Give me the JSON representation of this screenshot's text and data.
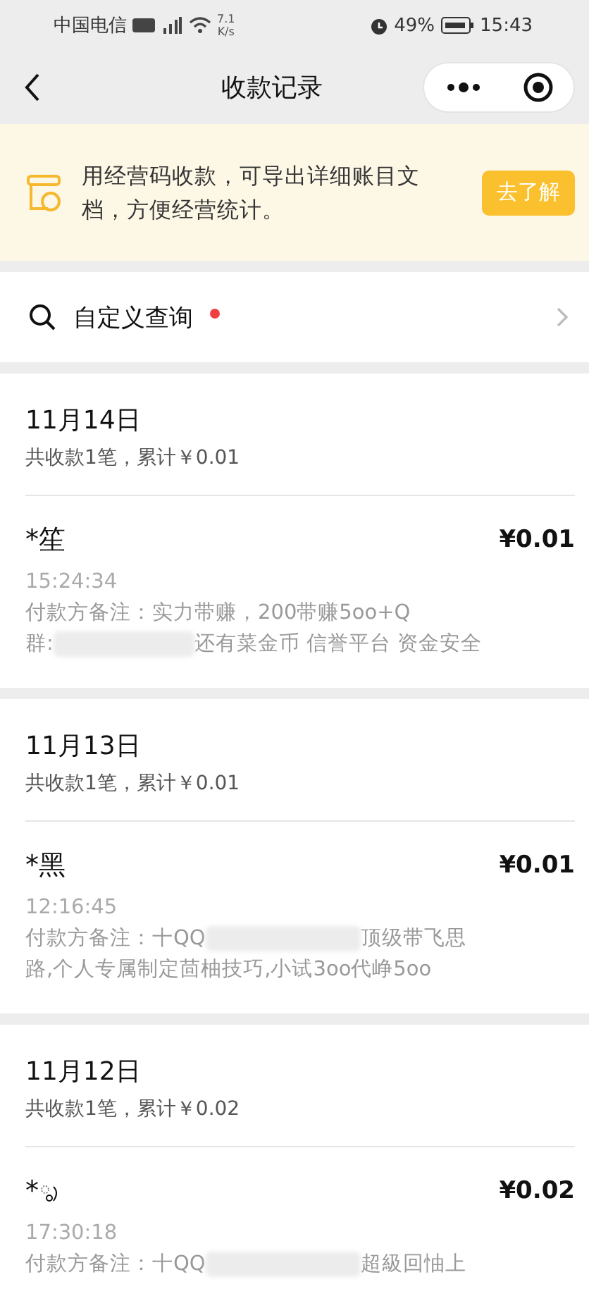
{
  "status_bar": {
    "carrier": "中国电信",
    "speed_value": "7.1",
    "speed_unit": "K/s",
    "battery": "49%",
    "time": "15:43"
  },
  "nav": {
    "title": "收款记录"
  },
  "banner": {
    "text": "用经营码收款，可导出详细账目文档，方便经营统计。",
    "button": "去了解"
  },
  "query": {
    "label": "自定义查询",
    "unread": true
  },
  "days": [
    {
      "date": "11月14日",
      "summary": "共收款1笔，累计￥0.01",
      "payments": [
        {
          "name": "*笙",
          "emoji": false,
          "amount": "¥0.01",
          "time": "15:24:34",
          "note_lines": [
            [
              {
                "kind": "text",
                "text": "付款方备注：实力带赚，200带赚5oo+Q"
              }
            ],
            [
              {
                "kind": "text",
                "text": "群:"
              },
              {
                "kind": "redacted"
              },
              {
                "kind": "text",
                "text": "还有菜金币 信誉平台 资金安全"
              }
            ]
          ]
        }
      ]
    },
    {
      "date": "11月13日",
      "summary": "共收款1笔，累计￥0.01",
      "payments": [
        {
          "name": "*黑",
          "emoji": false,
          "amount": "¥0.01",
          "time": "12:16:45",
          "note_lines": [
            [
              {
                "kind": "text",
                "text": "付款方备注：十QQ"
              },
              {
                "kind": "redacted"
              },
              {
                "kind": "text",
                "text": "顶级带飞思"
              }
            ],
            [
              {
                "kind": "text",
                "text": "路,个人专属制定茴柚技巧,小试3oo代峥5oo"
              }
            ]
          ]
        }
      ]
    },
    {
      "date": "11月12日",
      "summary": "共收款1笔，累计￥0.02",
      "payments": [
        {
          "name": "*",
          "emoji": true,
          "amount": "¥0.02",
          "time": "17:30:18",
          "note_lines": [
            [
              {
                "kind": "text",
                "text": "付款方备注：十QQ"
              },
              {
                "kind": "redacted"
              },
              {
                "kind": "text",
                "text": "超級回怞上"
              }
            ]
          ]
        }
      ]
    }
  ]
}
